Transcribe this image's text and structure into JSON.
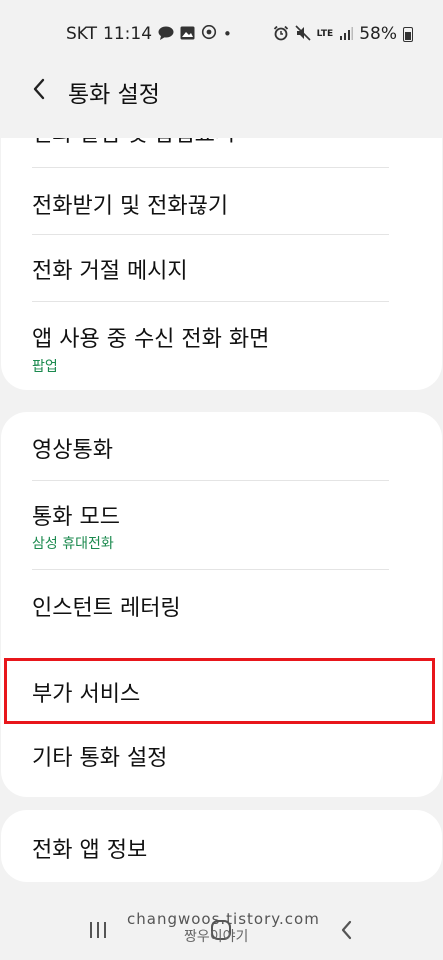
{
  "status_bar": {
    "carrier": "SKT",
    "time": "11:14",
    "lte": "LTE",
    "battery": "58%"
  },
  "header": {
    "title": "통화 설정"
  },
  "groups": [
    {
      "items": [
        {
          "label": "전화 알림 및 팝업표시"
        },
        {
          "label": "전화받기 및 전화끊기"
        },
        {
          "label": "전화 거절 메시지"
        },
        {
          "label": "앱 사용 중 수신 전화 화면",
          "sub": "팝업"
        }
      ]
    },
    {
      "items": [
        {
          "label": "영상통화"
        },
        {
          "label": "통화 모드",
          "sub": "삼성 휴대전화"
        },
        {
          "label": "인스턴트 레터링"
        },
        {
          "label": "부가 서비스"
        },
        {
          "label": "기타 통화 설정"
        }
      ]
    },
    {
      "items": [
        {
          "label": "전화 앱 정보"
        }
      ]
    }
  ],
  "highlight_color": "#e8161b",
  "accent_color": "#1c8a4f",
  "watermark": {
    "url": "changwoos.tistory.com",
    "name": "짱우이야기"
  },
  "nav": {
    "recents_icon": "recents-icon",
    "home_icon": "home-icon",
    "back_icon": "back-icon"
  }
}
